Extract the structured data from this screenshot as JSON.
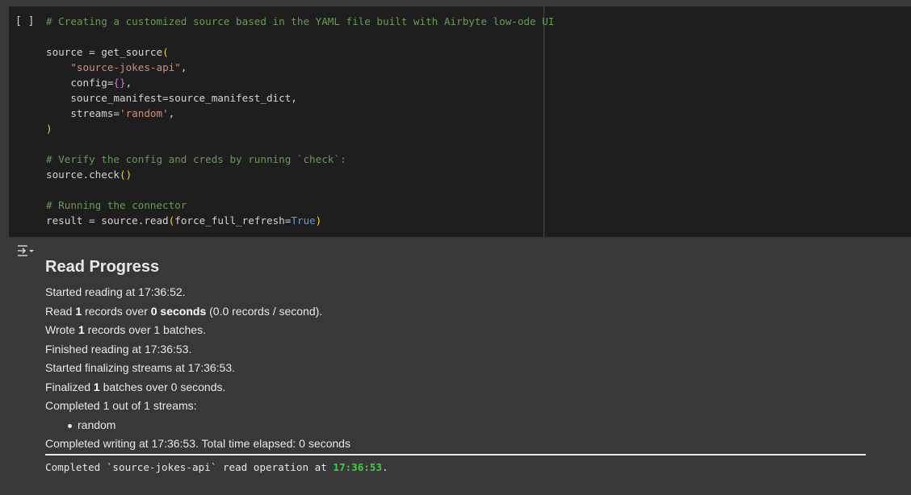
{
  "cell": {
    "run_marker": "[ ]",
    "code_lines": [
      {
        "parts": [
          {
            "cls": "c-com",
            "t": "# Creating a customized source based in the YAML file built with Airbyte low-ode UI"
          }
        ]
      },
      {
        "parts": []
      },
      {
        "parts": [
          {
            "cls": "",
            "t": "source = get_source"
          },
          {
            "cls": "c-paren",
            "t": "("
          }
        ]
      },
      {
        "parts": [
          {
            "cls": "",
            "t": "    "
          },
          {
            "cls": "c-str",
            "t": "\"source-jokes-api\""
          },
          {
            "cls": "",
            "t": ","
          }
        ]
      },
      {
        "parts": [
          {
            "cls": "",
            "t": "    config="
          },
          {
            "cls": "c-brace",
            "t": "{}"
          },
          {
            "cls": "",
            "t": ","
          }
        ]
      },
      {
        "parts": [
          {
            "cls": "",
            "t": "    source_manifest=source_manifest_dict,"
          }
        ]
      },
      {
        "parts": [
          {
            "cls": "",
            "t": "    streams="
          },
          {
            "cls": "c-str",
            "t": "'random'"
          },
          {
            "cls": "",
            "t": ","
          }
        ]
      },
      {
        "parts": [
          {
            "cls": "c-paren",
            "t": ")"
          }
        ]
      },
      {
        "parts": []
      },
      {
        "parts": [
          {
            "cls": "c-com",
            "t": "# Verify the config and creds by running `check`:"
          }
        ]
      },
      {
        "parts": [
          {
            "cls": "",
            "t": "source.check"
          },
          {
            "cls": "c-paren",
            "t": "()"
          }
        ]
      },
      {
        "parts": []
      },
      {
        "parts": [
          {
            "cls": "c-com",
            "t": "# Running the connector"
          }
        ]
      },
      {
        "parts": [
          {
            "cls": "",
            "t": "result = source.read"
          },
          {
            "cls": "c-paren",
            "t": "("
          },
          {
            "cls": "",
            "t": "force_full_refresh="
          },
          {
            "cls": "c-const",
            "t": "True"
          },
          {
            "cls": "c-paren",
            "t": ")"
          }
        ]
      }
    ]
  },
  "output": {
    "heading": "Read Progress",
    "started_reading": "Started reading at 17:36:52.",
    "read_line": {
      "a": "Read ",
      "records": "1",
      "b": " records over ",
      "seconds": "0 seconds",
      "c": " (0.0 records / second)."
    },
    "wrote_line": {
      "a": "Wrote ",
      "records": "1",
      "b": " records over 1 batches."
    },
    "finished_reading": "Finished reading at 17:36:53.",
    "started_finalizing": "Started finalizing streams at 17:36:53.",
    "finalized_line": {
      "a": "Finalized ",
      "batches": "1",
      "b": " batches over 0 seconds."
    },
    "completed_streams": "Completed 1 out of 1 streams:",
    "streams": [
      "random"
    ],
    "completed_writing": "Completed writing at 17:36:53. Total time elapsed: 0 seconds",
    "final_message": {
      "a": "Completed `source-jokes-api` read operation at ",
      "time": "17:36:53",
      "b": "."
    }
  },
  "colors": {
    "code_bg": "#1e1e1e",
    "output_bg": "#383838",
    "comment": "#6a9955",
    "string": "#ce9178",
    "paren": "#ffd700",
    "brace": "#da70d6",
    "const": "#569cd6",
    "success_time": "#3cd33c"
  },
  "icons": {
    "output_toggle": "output-collapse-icon"
  }
}
